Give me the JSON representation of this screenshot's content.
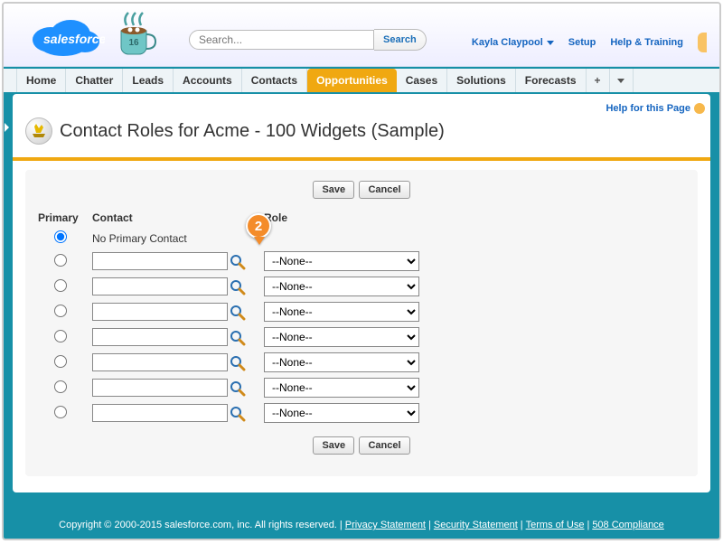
{
  "header": {
    "search_placeholder": "Search...",
    "search_button": "Search",
    "user_name": "Kayla Claypool",
    "setup_link": "Setup",
    "help_link": "Help & Training",
    "cocoa_day": "16"
  },
  "tabs": {
    "items": [
      "Home",
      "Chatter",
      "Leads",
      "Accounts",
      "Contacts",
      "Opportunities",
      "Cases",
      "Solutions",
      "Forecasts"
    ],
    "active_index": 5,
    "plus": "+"
  },
  "page": {
    "title": "Contact Roles for Acme - 100 Widgets (Sample)",
    "help_for_page": "Help for this Page"
  },
  "form": {
    "save_label": "Save",
    "cancel_label": "Cancel",
    "columns": {
      "primary": "Primary",
      "contact": "Contact",
      "role": "Role"
    },
    "no_primary_text": "No Primary Contact",
    "role_none": "--None--",
    "rows": [
      {
        "contact": "",
        "role": "--None--"
      },
      {
        "contact": "",
        "role": "--None--"
      },
      {
        "contact": "",
        "role": "--None--"
      },
      {
        "contact": "",
        "role": "--None--"
      },
      {
        "contact": "",
        "role": "--None--"
      },
      {
        "contact": "",
        "role": "--None--"
      },
      {
        "contact": "",
        "role": "--None--"
      }
    ]
  },
  "callout": {
    "number": "2"
  },
  "footer": {
    "copyright": "Copyright © 2000-2015 salesforce.com, inc. All rights reserved.",
    "links": [
      "Privacy Statement",
      "Security Statement",
      "Terms of Use",
      "508 Compliance"
    ]
  }
}
